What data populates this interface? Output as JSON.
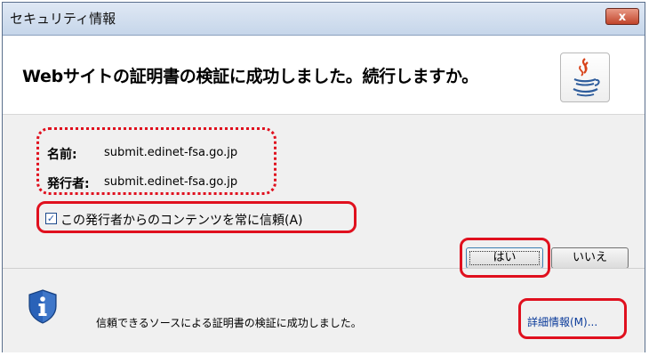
{
  "window": {
    "title": "セキュリティ情報",
    "close_label": "x"
  },
  "header": {
    "headline": "Webサイトの証明書の検証に成功しました。続行しますか。",
    "logo_icon": "java-coffee-icon"
  },
  "details": {
    "name_label": "名前:",
    "name_value": "submit.edinet-fsa.go.jp",
    "publisher_label": "発行者:",
    "publisher_value": "submit.edinet-fsa.go.jp"
  },
  "trust": {
    "checked": true,
    "label": "この発行者からのコンテンツを常に信頼(A)"
  },
  "buttons": {
    "yes": "はい",
    "no": "いいえ"
  },
  "footer": {
    "icon": "info-shield-icon",
    "message": "信頼できるソースによる証明書の検証に成功しました。",
    "more_info": "詳細情報(M)..."
  },
  "colors": {
    "highlight": "#e0101e",
    "shield": "#2a62b8"
  }
}
